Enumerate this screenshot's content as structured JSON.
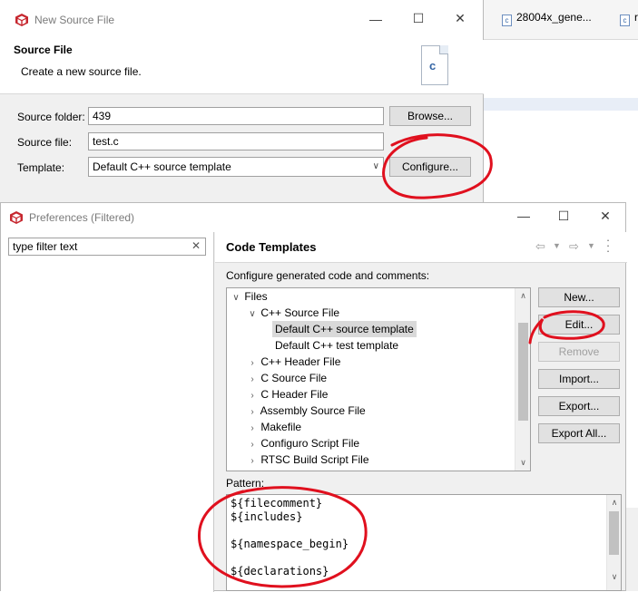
{
  "background": {
    "tabs": [
      {
        "label": "28004x_gene...",
        "icon": "c-file-icon"
      },
      {
        "label": "r",
        "icon": "c-file-icon"
      }
    ]
  },
  "new_source_dialog": {
    "title": "New Source File",
    "header_title": "Source File",
    "header_desc": "Create a new source file.",
    "source_folder_label": "Source folder:",
    "source_folder_value": "439",
    "browse_label": "Browse...",
    "source_file_label": "Source file:",
    "source_file_value": "test.c",
    "template_label": "Template:",
    "template_value": "Default C++ source template",
    "configure_label": "Configure...",
    "file_glyph": "c"
  },
  "preferences_dialog": {
    "title": "Preferences (Filtered)",
    "filter_placeholder": "type filter text",
    "page_title": "Code Templates",
    "description": "Configure generated code and comments:",
    "tree": [
      {
        "label": "Files",
        "indent": 0,
        "chevron": "down"
      },
      {
        "label": "C++ Source File",
        "indent": 1,
        "chevron": "down"
      },
      {
        "label": "Default C++ source template",
        "indent": 2,
        "chevron": "",
        "selected": true
      },
      {
        "label": "Default C++ test template",
        "indent": 2,
        "chevron": ""
      },
      {
        "label": "C++ Header File",
        "indent": 1,
        "chevron": "right"
      },
      {
        "label": "C Source File",
        "indent": 1,
        "chevron": "right"
      },
      {
        "label": "C Header File",
        "indent": 1,
        "chevron": "right"
      },
      {
        "label": "Assembly Source File",
        "indent": 1,
        "chevron": "right"
      },
      {
        "label": "Makefile",
        "indent": 1,
        "chevron": "right"
      },
      {
        "label": "Configuro Script File",
        "indent": 1,
        "chevron": "right"
      },
      {
        "label": "RTSC Build Script File",
        "indent": 1,
        "chevron": "right"
      }
    ],
    "buttons": {
      "new": "New...",
      "edit": "Edit...",
      "remove": "Remove",
      "import": "Import...",
      "export": "Export...",
      "export_all": "Export All..."
    },
    "pattern_label": "Pattern:",
    "pattern_lines": [
      "${filecomment}",
      "${includes}",
      "",
      "${namespace_begin}",
      "",
      "${declarations}"
    ]
  },
  "annotation_color": "#e0101e"
}
